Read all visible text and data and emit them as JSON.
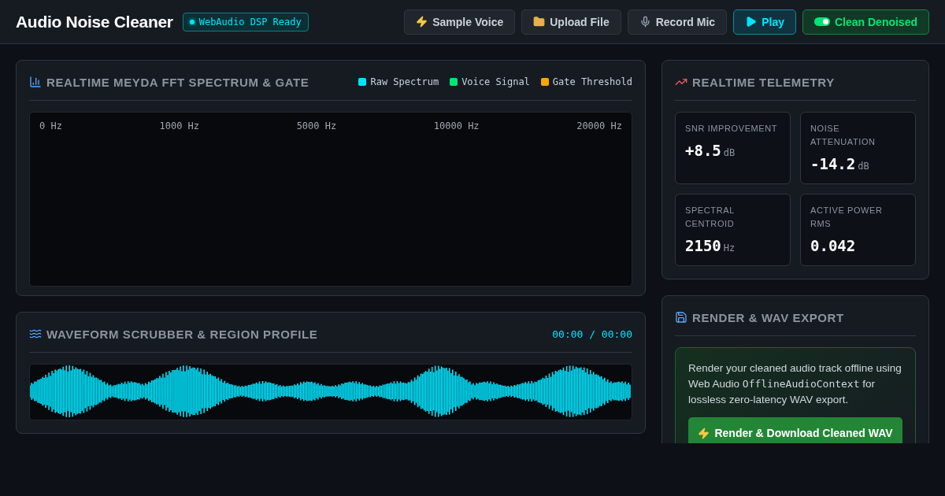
{
  "header": {
    "title": "Audio Noise Cleaner",
    "status_badge": "WebAudio DSP Ready",
    "buttons": [
      {
        "kind": "plain",
        "label": "Sample Voice"
      },
      {
        "kind": "plain",
        "label": "Upload File"
      },
      {
        "kind": "plain",
        "label": "Record Mic"
      },
      {
        "kind": "play",
        "label": "Play"
      },
      {
        "kind": "toggle",
        "label": "Clean Denoised",
        "on": true
      }
    ]
  },
  "spectrum": {
    "title": "REALTIME MEYDA FFT SPECTRUM & GATE",
    "legend": [
      {
        "label": "Raw Spectrum",
        "color": "#00e5ff"
      },
      {
        "label": "Voice Signal",
        "color": "#00e676"
      },
      {
        "label": "Gate Threshold",
        "color": "#ffa500"
      }
    ],
    "frequency_labels": [
      "0 Hz",
      "1000 Hz",
      "5000 Hz",
      "10000 Hz",
      "20000 Hz"
    ]
  },
  "waveform": {
    "title": "WAVEFORM SCRUBBER & REGION PROFILE",
    "time": "00:00 / 00:00"
  },
  "telemetry": {
    "title": "REALTIME TELEMETRY",
    "metrics": [
      {
        "label": "SNR IMPROVEMENT",
        "value": "+8.5",
        "unit": "dB"
      },
      {
        "label": "NOISE ATTENUATION",
        "value": "-14.2",
        "unit": "dB"
      },
      {
        "label": "SPECTRAL CENTROID",
        "value": "2150",
        "unit": "Hz"
      },
      {
        "label": "ACTIVE POWER RMS",
        "value": "0.042"
      }
    ]
  },
  "export": {
    "title": "RENDER & WAV EXPORT",
    "description": [
      {
        "kind": "text",
        "text": "Render your cleaned audio track offline using Web Audio "
      },
      {
        "kind": "code",
        "text": "OfflineAudioContext"
      },
      {
        "kind": "text",
        "text": " for lossless zero-latency WAV export."
      }
    ],
    "button": "Render & Download Cleaned WAV"
  }
}
